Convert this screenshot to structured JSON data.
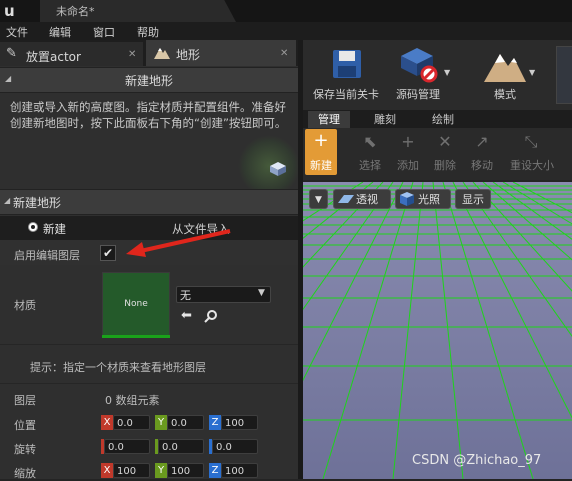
{
  "window": {
    "doc_title": "未命名*"
  },
  "menu": [
    "文件",
    "编辑",
    "窗口",
    "帮助"
  ],
  "panel_tabs": {
    "place": "放置actor",
    "landscape": "地形"
  },
  "new_landscape_header": "新建地形",
  "description": "创建或导入新的高度图。指定材质并配置组件。准备好创建新地图时，按下此面板右下角的“创建”按钮即可。",
  "section": {
    "title": "新建地形",
    "radio_new": "新建",
    "radio_import": "从文件导入",
    "edit_layers_label": "启用编辑图层",
    "material_label": "材质",
    "material_thumb": "None",
    "material_value": "无",
    "hint": "提示：指定一个材质来查看地形图层",
    "layers_label": "图层",
    "layers_value": "0 数组元素",
    "location_label": "位置",
    "location": {
      "x": "0.0",
      "y": "0.0",
      "z": "100"
    },
    "rotation_label": "旋转",
    "rotation": {
      "x": "0.0",
      "y": "0.0",
      "z": "0.0"
    },
    "scale_label": "缩放",
    "scale": {
      "x": "100",
      "y": "100",
      "z": "100"
    }
  },
  "toolbar": {
    "save": "保存当前关卡",
    "source": "源码管理",
    "modes": "模式"
  },
  "mode_tabs": [
    "管理",
    "雕刻",
    "绘制"
  ],
  "sub_tools": {
    "new": "新建",
    "select": "选择",
    "add": "添加",
    "delete": "删除",
    "move": "移动",
    "resize": "重设大小"
  },
  "viewport": {
    "perspective": "透视",
    "lit": "光照",
    "show": "显示"
  },
  "watermark": "CSDN @Zhichao_97",
  "colors": {
    "grid": "#25c020",
    "sky": "#7a7ea6",
    "accent": "#e8a23a"
  }
}
